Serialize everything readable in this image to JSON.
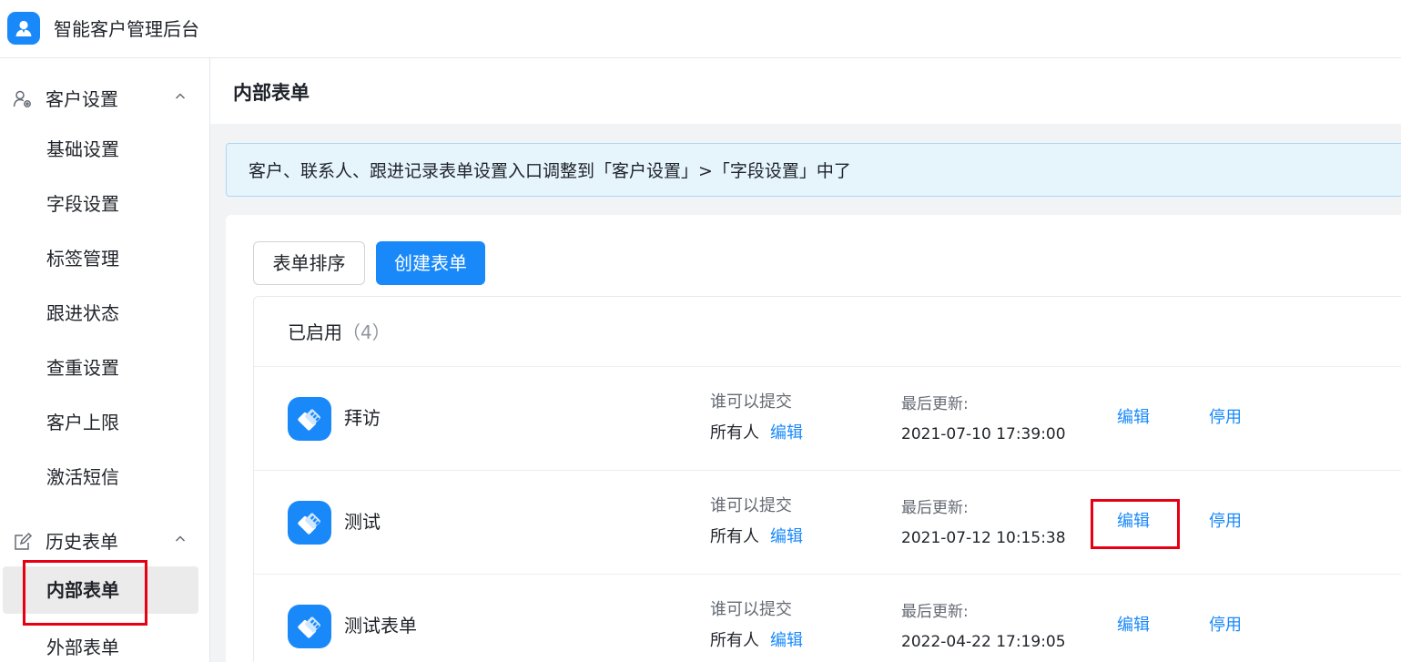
{
  "app": {
    "title": "智能客户管理后台",
    "logo_icon": "user-avatar-icon",
    "accent": "#1989fa"
  },
  "sidebar": {
    "groups": [
      {
        "label": "客户设置",
        "icon": "customer-settings-icon",
        "expanded": true,
        "items": [
          {
            "label": "基础设置"
          },
          {
            "label": "字段设置"
          },
          {
            "label": "标签管理"
          },
          {
            "label": "跟进状态"
          },
          {
            "label": "查重设置"
          },
          {
            "label": "客户上限"
          },
          {
            "label": "激活短信"
          }
        ]
      },
      {
        "label": "历史表单",
        "icon": "form-edit-icon",
        "expanded": true,
        "items": [
          {
            "label": "内部表单",
            "active": true
          },
          {
            "label": "外部表单"
          }
        ]
      }
    ]
  },
  "main": {
    "page_title": "内部表单",
    "notice": "客户、联系人、跟进记录表单设置入口调整到「客户设置」>「字段设置」中了",
    "toolbar": {
      "sort_label": "表单排序",
      "create_label": "创建表单"
    },
    "section": {
      "title": "已启用",
      "count": "（4）"
    },
    "forms": [
      {
        "name": "拜访",
        "who_label": "谁可以提交",
        "who_value": "所有人",
        "who_edit": "编辑",
        "updated_label": "最后更新:",
        "updated_at": "2021-07-10 17:39:00",
        "edit_label": "编辑",
        "disable_label": "停用"
      },
      {
        "name": "测试",
        "who_label": "谁可以提交",
        "who_value": "所有人",
        "who_edit": "编辑",
        "updated_label": "最后更新:",
        "updated_at": "2021-07-12 10:15:38",
        "edit_label": "编辑",
        "disable_label": "停用"
      },
      {
        "name": "测试表单",
        "who_label": "谁可以提交",
        "who_value": "所有人",
        "who_edit": "编辑",
        "updated_label": "最后更新:",
        "updated_at": "2022-04-22 17:19:05",
        "edit_label": "编辑",
        "disable_label": "停用"
      }
    ]
  },
  "highlights": {
    "color": "#e60012"
  }
}
